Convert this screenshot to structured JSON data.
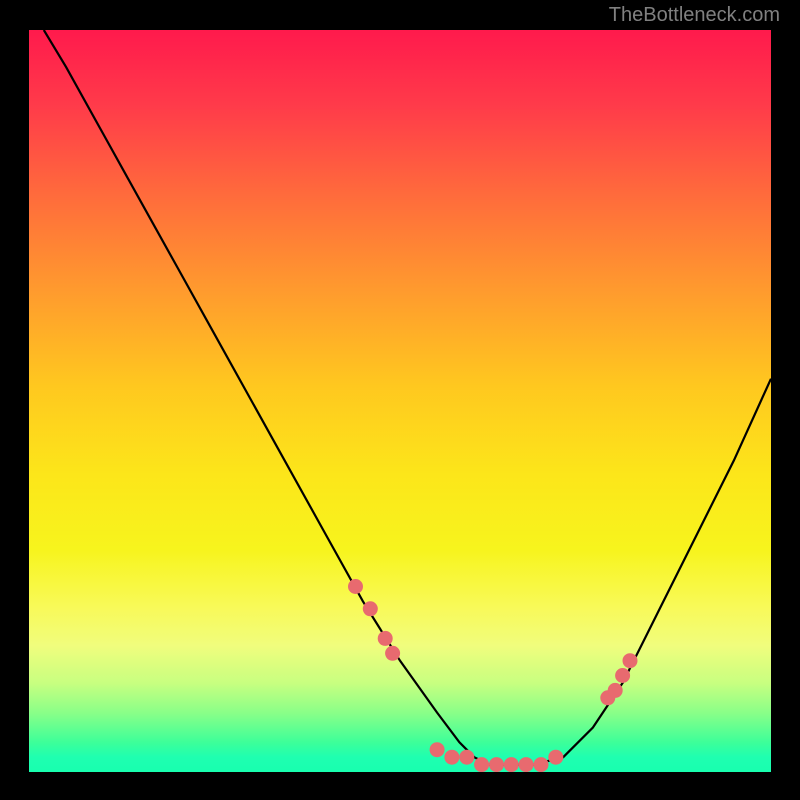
{
  "watermark": "TheBottleneck.com",
  "chart_data": {
    "type": "line",
    "title": "",
    "xlabel": "",
    "ylabel": "",
    "xlim": [
      0,
      100
    ],
    "ylim": [
      0,
      100
    ],
    "curve": {
      "x": [
        2,
        5,
        10,
        15,
        20,
        25,
        30,
        35,
        40,
        45,
        50,
        55,
        58,
        60,
        62,
        65,
        68,
        72,
        76,
        80,
        85,
        90,
        95,
        100
      ],
      "y": [
        100,
        95,
        86,
        77,
        68,
        59,
        50,
        41,
        32,
        23,
        15,
        8,
        4,
        2,
        1,
        1,
        1,
        2,
        6,
        12,
        22,
        32,
        42,
        53
      ]
    },
    "points": {
      "x": [
        44,
        46,
        48,
        49,
        55,
        57,
        59,
        61,
        63,
        65,
        67,
        69,
        71,
        78,
        79,
        80,
        81
      ],
      "y": [
        25,
        22,
        18,
        16,
        3,
        2,
        2,
        1,
        1,
        1,
        1,
        1,
        2,
        10,
        11,
        13,
        15
      ]
    }
  }
}
